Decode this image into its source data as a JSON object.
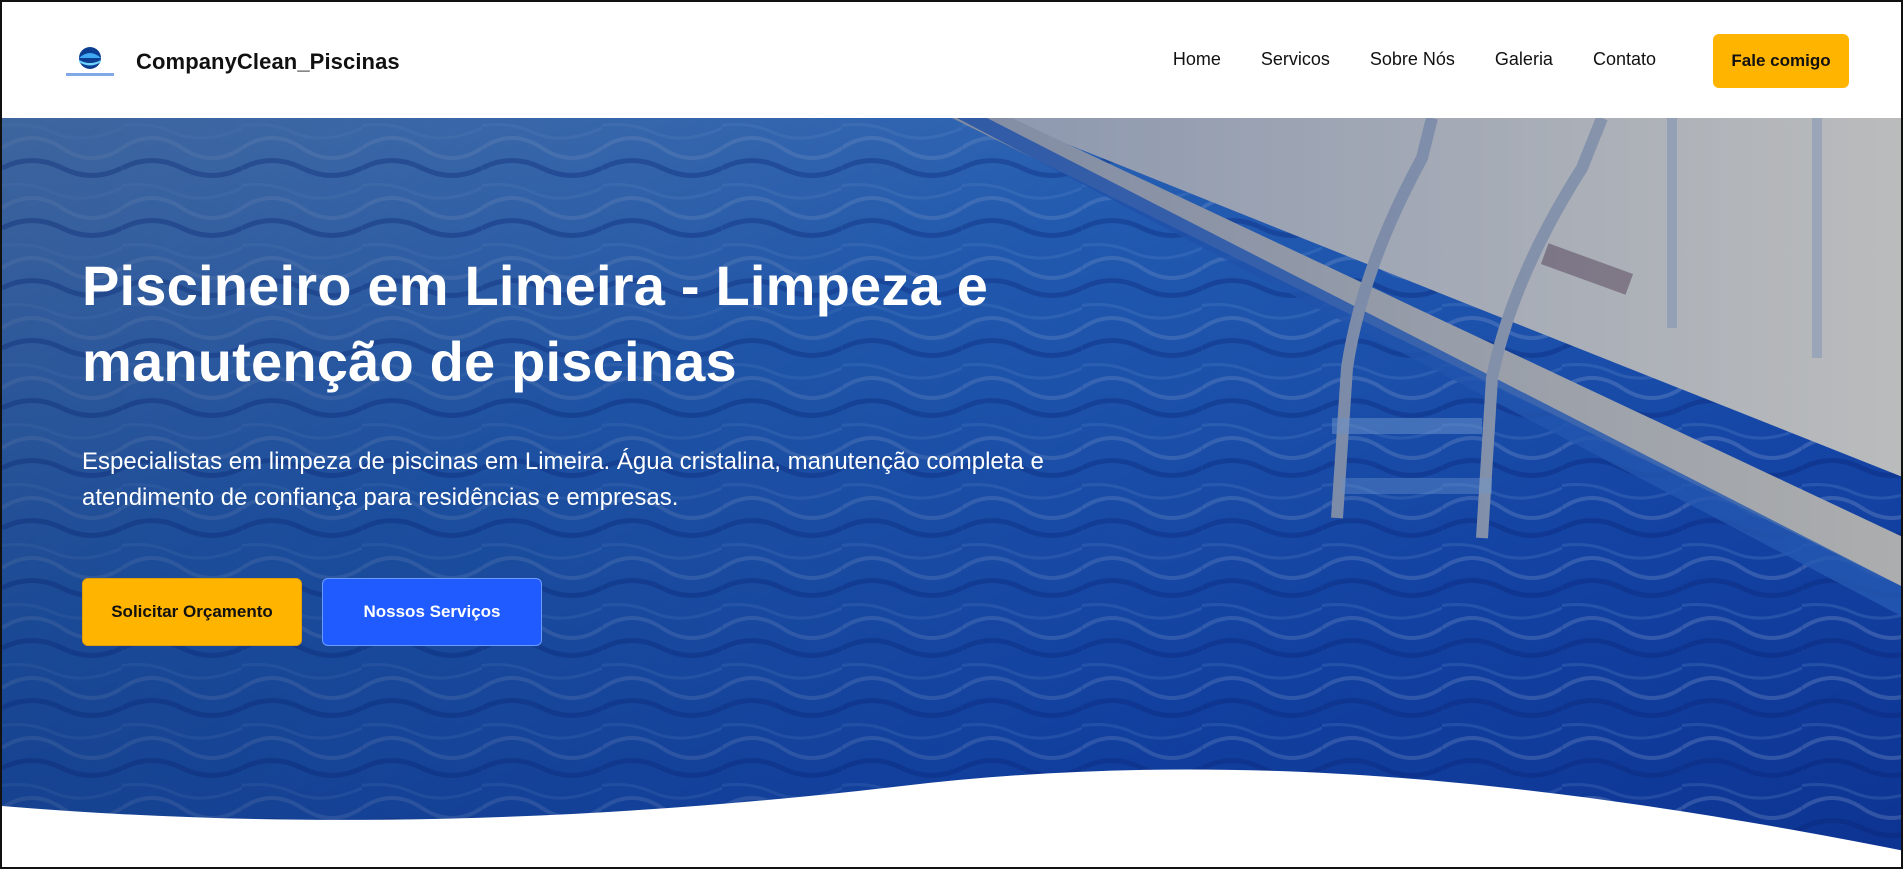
{
  "header": {
    "brand_name": "CompanyClean_Piscinas",
    "logo_icon": "pool-logo-icon",
    "nav": [
      {
        "label": "Home"
      },
      {
        "label": "Servicos"
      },
      {
        "label": "Sobre Nós"
      },
      {
        "label": "Galeria"
      },
      {
        "label": "Contato"
      }
    ],
    "cta_label": "Fale comigo"
  },
  "hero": {
    "title": "Piscineiro em Limeira - Limpeza e manutenção de piscinas",
    "subtitle": "Especialistas em limpeza de piscinas em Limeira. Água cristalina, manutenção completa e atendimento de confiança para residências e empresas.",
    "primary_button": "Solicitar Orçamento",
    "secondary_button": "Nossos Serviços"
  },
  "colors": {
    "accent_yellow": "#ffb400",
    "accent_blue": "#1f5bff",
    "text_dark": "#111111"
  }
}
